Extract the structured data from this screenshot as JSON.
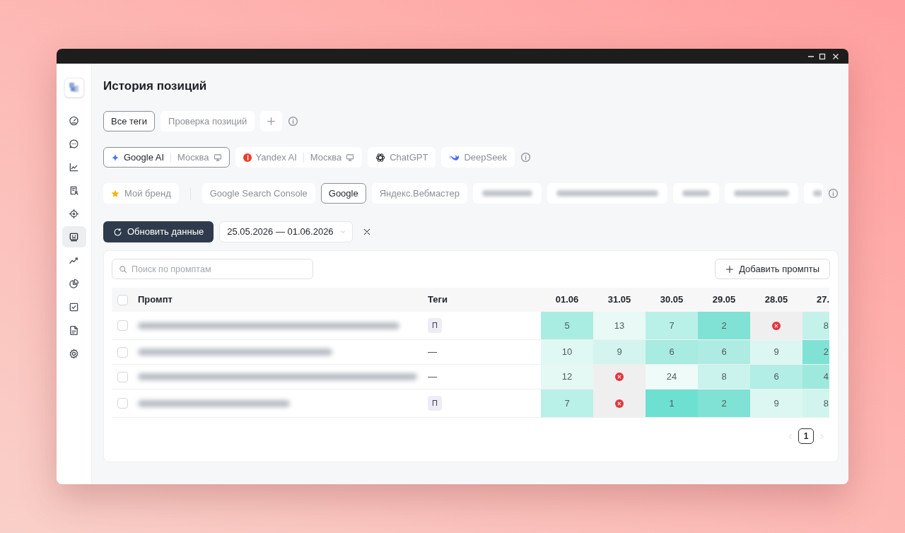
{
  "sidebar": {
    "items": [
      {
        "selected": false
      },
      {
        "selected": false
      },
      {
        "selected": false
      },
      {
        "selected": false
      },
      {
        "selected": false
      },
      {
        "selected": true
      },
      {
        "selected": false
      },
      {
        "selected": false
      },
      {
        "selected": false
      },
      {
        "selected": false
      },
      {
        "selected": false
      }
    ]
  },
  "page_title": "История позиций",
  "tag_tabs": [
    {
      "label": "Все теги",
      "selected": true
    },
    {
      "label": "Проверка позиций",
      "selected": false
    }
  ],
  "engines": [
    {
      "label": "Google AI",
      "region": "Москва",
      "selected": true
    },
    {
      "label": "Yandex AI",
      "region": "Москва",
      "selected": false
    },
    {
      "label": "ChatGPT",
      "selected": false
    },
    {
      "label": "DeepSeek",
      "selected": false
    }
  ],
  "sources": [
    {
      "kind": "brand",
      "label": "Мой бренд",
      "selected": false
    },
    {
      "kind": "source",
      "label": "Google Search Console",
      "selected": false
    },
    {
      "kind": "source",
      "label": "Google",
      "selected": true
    },
    {
      "kind": "source",
      "label": "Яндекс.Вебмастер",
      "selected": false
    },
    {
      "kind": "blurred",
      "selected": false
    },
    {
      "kind": "blurred",
      "selected": false
    },
    {
      "kind": "blurred",
      "selected": false
    },
    {
      "kind": "blurred",
      "selected": false
    },
    {
      "kind": "blurred",
      "selected": false
    }
  ],
  "refresh_button": {
    "label": "Обновить данные"
  },
  "date_range": {
    "value": "25.05.2026 — 01.06.2026"
  },
  "search": {
    "placeholder": "Поиск по промптам"
  },
  "add_button": {
    "label": "Добавить промпты"
  },
  "table": {
    "header_checked": false,
    "columns": [
      {
        "kind": "prompt",
        "label": "Промпт"
      },
      {
        "kind": "tags",
        "label": "Теги"
      },
      {
        "kind": "date",
        "label": "01.06"
      },
      {
        "kind": "date",
        "label": "31.05"
      },
      {
        "kind": "date",
        "label": "30.05"
      },
      {
        "kind": "date",
        "label": "29.05"
      },
      {
        "kind": "date",
        "label": "28.05"
      },
      {
        "kind": "date",
        "label": "27."
      }
    ],
    "rows": [
      {
        "checked": false,
        "cells": [
          {
            "kind": "blurred"
          },
          {
            "kind": "badge",
            "text": "П"
          },
          {
            "kind": "value",
            "text": "5",
            "color": "#a8ece2"
          },
          {
            "kind": "value",
            "text": "13",
            "color": "#e8f9f6"
          },
          {
            "kind": "value",
            "text": "7",
            "color": "#b9f0e8"
          },
          {
            "kind": "value",
            "text": "2",
            "color": "#7fe2d4"
          },
          {
            "kind": "error",
            "color": "#efefef"
          },
          {
            "kind": "value",
            "text": "8",
            "color": "#c4f2eb"
          }
        ]
      },
      {
        "checked": false,
        "cells": [
          {
            "kind": "blurred"
          },
          {
            "kind": "empty",
            "text": "—"
          },
          {
            "kind": "value",
            "text": "10",
            "color": "#e0f8f3"
          },
          {
            "kind": "value",
            "text": "9",
            "color": "#d4f5ef"
          },
          {
            "kind": "value",
            "text": "6",
            "color": "#a8ebe1"
          },
          {
            "kind": "value",
            "text": "6",
            "color": "#aeece3"
          },
          {
            "kind": "value",
            "text": "9",
            "color": "#dcf7f2"
          },
          {
            "kind": "value",
            "text": "2",
            "color": "#7fe2d4"
          }
        ]
      },
      {
        "checked": false,
        "cells": [
          {
            "kind": "blurred"
          },
          {
            "kind": "empty",
            "text": "—"
          },
          {
            "kind": "value",
            "text": "12",
            "color": "#e4f8f4"
          },
          {
            "kind": "error",
            "color": "#efefef"
          },
          {
            "kind": "value",
            "text": "24",
            "color": "#eefbf9"
          },
          {
            "kind": "value",
            "text": "8",
            "color": "#c9f3ec"
          },
          {
            "kind": "value",
            "text": "6",
            "color": "#b2eee5"
          },
          {
            "kind": "value",
            "text": "4",
            "color": "#9ee9de"
          }
        ]
      },
      {
        "checked": false,
        "cells": [
          {
            "kind": "blurred"
          },
          {
            "kind": "badge",
            "text": "П"
          },
          {
            "kind": "value",
            "text": "7",
            "color": "#b9f0e8"
          },
          {
            "kind": "error",
            "color": "#efefef"
          },
          {
            "kind": "value",
            "text": "1",
            "color": "#6ee0d2"
          },
          {
            "kind": "value",
            "text": "2",
            "color": "#7fe2d4"
          },
          {
            "kind": "value",
            "text": "9",
            "color": "#dcf7f2"
          },
          {
            "kind": "value",
            "text": "8",
            "color": "#d1f4ee"
          }
        ]
      }
    ]
  },
  "pagination": {
    "prev_disabled": true,
    "next_disabled": true,
    "pages": [
      {
        "label": "1",
        "selected": true
      }
    ]
  }
}
